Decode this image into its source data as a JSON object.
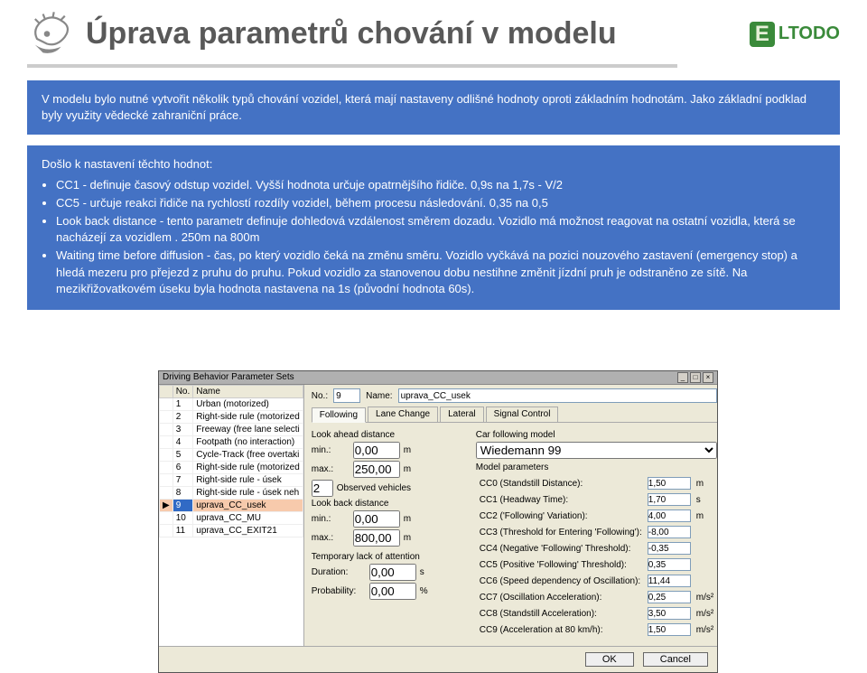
{
  "slide": {
    "title": "Úprava parametrů chování v modelu",
    "logo_text": "LTODO",
    "logo_e": "E"
  },
  "intro": {
    "text": "V modelu bylo nutné vytvořit několik typů chování vozidel, která mají nastaveny odlišné hodnoty oproti základním hodnotám. Jako základní podklad byly využity vědecké zahraniční práce."
  },
  "settings": {
    "heading": "Došlo k nastavení těchto hodnot:",
    "items": [
      "CC1 - definuje časový odstup vozidel. Vyšší hodnota určuje opatrnějšího řidiče.                                                              0,9s na 1,7s  - V/2",
      "CC5 - určuje reakci řidiče na rychlostí rozdíly vozidel, během procesu následování.                                                                0,35 na 0,5",
      "Look back distance - tento parametr definuje dohledová vzdálenost směrem dozadu. Vozidlo má možnost reagovat na                       ostatní vozidla, která se nacházejí za vozidlem .                                                                                       250m na 800m",
      "Waiting time before diffusion - čas, po který vozidlo čeká na změnu směru. Vozidlo vyčkává na pozici nouzového zastavení (emergency stop) a hledá mezeru pro přejezd z pruhu do pruhu. Pokud vozidlo za stanovenou dobu nestihne změnit jízdní pruh je odstraněno ze sítě. Na mezikřižovatkovém úseku byla hodnota nastavena na 1s (původní hodnota 60s)."
    ]
  },
  "dialog": {
    "title": "Driving Behavior Parameter Sets",
    "list": {
      "cols": [
        "No.",
        "Name"
      ],
      "rows": [
        {
          "no": "1",
          "name": "Urban (motorized)"
        },
        {
          "no": "2",
          "name": "Right-side rule (motorized"
        },
        {
          "no": "3",
          "name": "Freeway (free lane selecti"
        },
        {
          "no": "4",
          "name": "Footpath (no interaction)"
        },
        {
          "no": "5",
          "name": "Cycle-Track (free overtaki"
        },
        {
          "no": "6",
          "name": "Right-side rule (motorized"
        },
        {
          "no": "7",
          "name": "Right-side rule - úsek"
        },
        {
          "no": "8",
          "name": "Right-side rule - úsek neh"
        },
        {
          "no": "9",
          "name": "uprava_CC_usek",
          "selected": true
        },
        {
          "no": "10",
          "name": "uprava_CC_MU"
        },
        {
          "no": "11",
          "name": "uprava_CC_EXIT21"
        }
      ]
    },
    "form": {
      "no_label": "No.:",
      "no_value": "9",
      "name_label": "Name:",
      "name_value": "uprava_CC_usek",
      "tabs": [
        "Following",
        "Lane Change",
        "Lateral",
        "Signal Control"
      ],
      "look_ahead_label": "Look ahead distance",
      "la_min_label": "min.:",
      "la_min": "0,00",
      "la_min_u": "m",
      "la_max_label": "max.:",
      "la_max": "250,00",
      "la_max_u": "m",
      "observed_label": "Observed vehicles",
      "observed": "2",
      "look_back_label": "Look back distance",
      "lb_min_label": "min.:",
      "lb_min": "0,00",
      "lb_min_u": "m",
      "lb_max_label": "max.:",
      "lb_max": "800,00",
      "lb_max_u": "m",
      "tloa_label": "Temporary lack of attention",
      "dur_label": "Duration:",
      "dur": "0,00",
      "dur_u": "s",
      "prob_label": "Probability:",
      "prob": "0,00",
      "prob_u": "%",
      "cfm_label": "Car following model",
      "cfm_value": "Wiedemann 99",
      "mp_label": "Model parameters",
      "params": [
        {
          "k": "CC0 (Standstill Distance):",
          "v": "1,50",
          "u": "m"
        },
        {
          "k": "CC1 (Headway Time):",
          "v": "1,70",
          "u": "s"
        },
        {
          "k": "CC2 ('Following' Variation):",
          "v": "4,00",
          "u": "m"
        },
        {
          "k": "CC3 (Threshold for Entering 'Following'):",
          "v": "-8,00",
          "u": ""
        },
        {
          "k": "CC4 (Negative 'Following' Threshold):",
          "v": "-0,35",
          "u": ""
        },
        {
          "k": "CC5 (Positive 'Following' Threshold):",
          "v": "0,35",
          "u": ""
        },
        {
          "k": "CC6 (Speed dependency of Oscillation):",
          "v": "11,44",
          "u": ""
        },
        {
          "k": "CC7 (Oscillation Acceleration):",
          "v": "0,25",
          "u": "m/s²"
        },
        {
          "k": "CC8 (Standstill Acceleration):",
          "v": "3,50",
          "u": "m/s²"
        },
        {
          "k": "CC9 (Acceleration at 80 km/h):",
          "v": "1,50",
          "u": "m/s²"
        }
      ]
    },
    "ok": "OK",
    "cancel": "Cancel"
  }
}
